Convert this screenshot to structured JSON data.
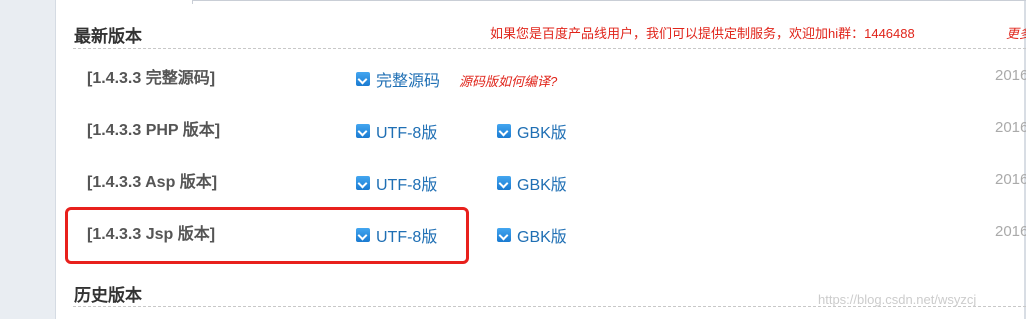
{
  "latest_section": {
    "title": "最新版本",
    "notice": "如果您是百度产品线用户，我们可以提供定制服务，欢迎加hi群：1446488",
    "notice_more": "更多"
  },
  "rows": [
    {
      "title": "[1.4.3.3 完整源码]",
      "link1": "完整源码",
      "extra": "源码版如何编译?",
      "date": "2016"
    },
    {
      "title": "[1.4.3.3 PHP 版本]",
      "link1": "UTF-8版",
      "link2": "GBK版",
      "date": "2016"
    },
    {
      "title": "[1.4.3.3 Asp 版本]",
      "link1": "UTF-8版",
      "link2": "GBK版",
      "date": "2016"
    },
    {
      "title": "[1.4.3.3 Jsp 版本]",
      "link1": "UTF-8版",
      "link2": "GBK版",
      "date": "2016"
    }
  ],
  "history_section": {
    "title": "历史版本"
  },
  "watermark": "https://blog.csdn.net/wsyzcj",
  "colors": {
    "link": "#1f6fb4",
    "notice": "#e0251b",
    "highlight": "#e8201c",
    "heading": "#333333"
  },
  "icons": {
    "download": "download-arrow-icon"
  }
}
